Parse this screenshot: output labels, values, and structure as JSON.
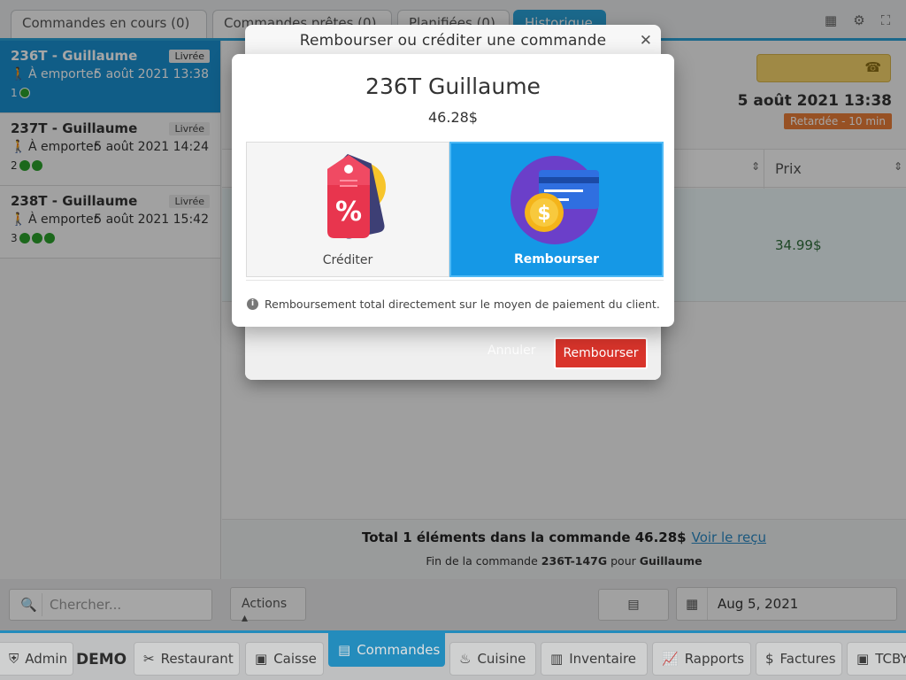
{
  "tabs": [
    {
      "label": "Commandes en cours (0)"
    },
    {
      "label": "Commandes prêtes (0)"
    },
    {
      "label": "Planifiées (0)"
    },
    {
      "label": "Historique"
    }
  ],
  "orders": [
    {
      "number": "236T",
      "customer": "Guillaume",
      "status": "Livrée",
      "mode": "À emporter",
      "time": "5 août 2021 13:38",
      "seq": "1",
      "dots": 1
    },
    {
      "number": "237T",
      "customer": "Guillaume",
      "status": "Livrée",
      "mode": "À emporter",
      "time": "5 août 2021 14:24",
      "seq": "2",
      "dots": 2
    },
    {
      "number": "238T",
      "customer": "Guillaume",
      "status": "Livrée",
      "mode": "À emporter",
      "time": "5 août 2021 15:42",
      "seq": "3",
      "dots": 3
    }
  ],
  "detail": {
    "date": "5 août 2021 13:38",
    "late_badge": "Retardée - 10 min",
    "col_price": "Prix",
    "row_price": "34.99$",
    "total_text": "Total 1 éléments dans la commande 46.28$",
    "receipt_link": "Voir le reçu",
    "end_prefix": "Fin de la commande",
    "end_code": "236T-147G",
    "end_mid": "pour",
    "end_customer": "Guillaume"
  },
  "bottom": {
    "search_placeholder": "Chercher...",
    "actions_label": "Actions",
    "date_value": "Aug 5, 2021"
  },
  "nav": {
    "admin": "Admin",
    "demo": "DEMO",
    "items": [
      {
        "label": "Restaurant"
      },
      {
        "label": "Caisse"
      },
      {
        "label": "Commandes"
      },
      {
        "label": "Cuisine"
      },
      {
        "label": "Inventaire"
      },
      {
        "label": "Rapports"
      },
      {
        "label": "Factures"
      },
      {
        "label": "TCBY"
      }
    ]
  },
  "dialog": {
    "title": "Rembourser ou créditer une commande",
    "cancel_label": "Annuler",
    "confirm_label": "Rembourser"
  },
  "modal": {
    "name": "236T Guillaume",
    "amount": "46.28$",
    "credit_label": "Créditer",
    "refund_label": "Rembourser",
    "info": "Remboursement total directement sur le moyen de paiement du client."
  },
  "colors": {
    "accent": "#2aa0d6",
    "selected_order": "#1a8fd0",
    "danger": "#d9342b",
    "late": "#e87d38",
    "dot_green": "#2ca02c"
  }
}
